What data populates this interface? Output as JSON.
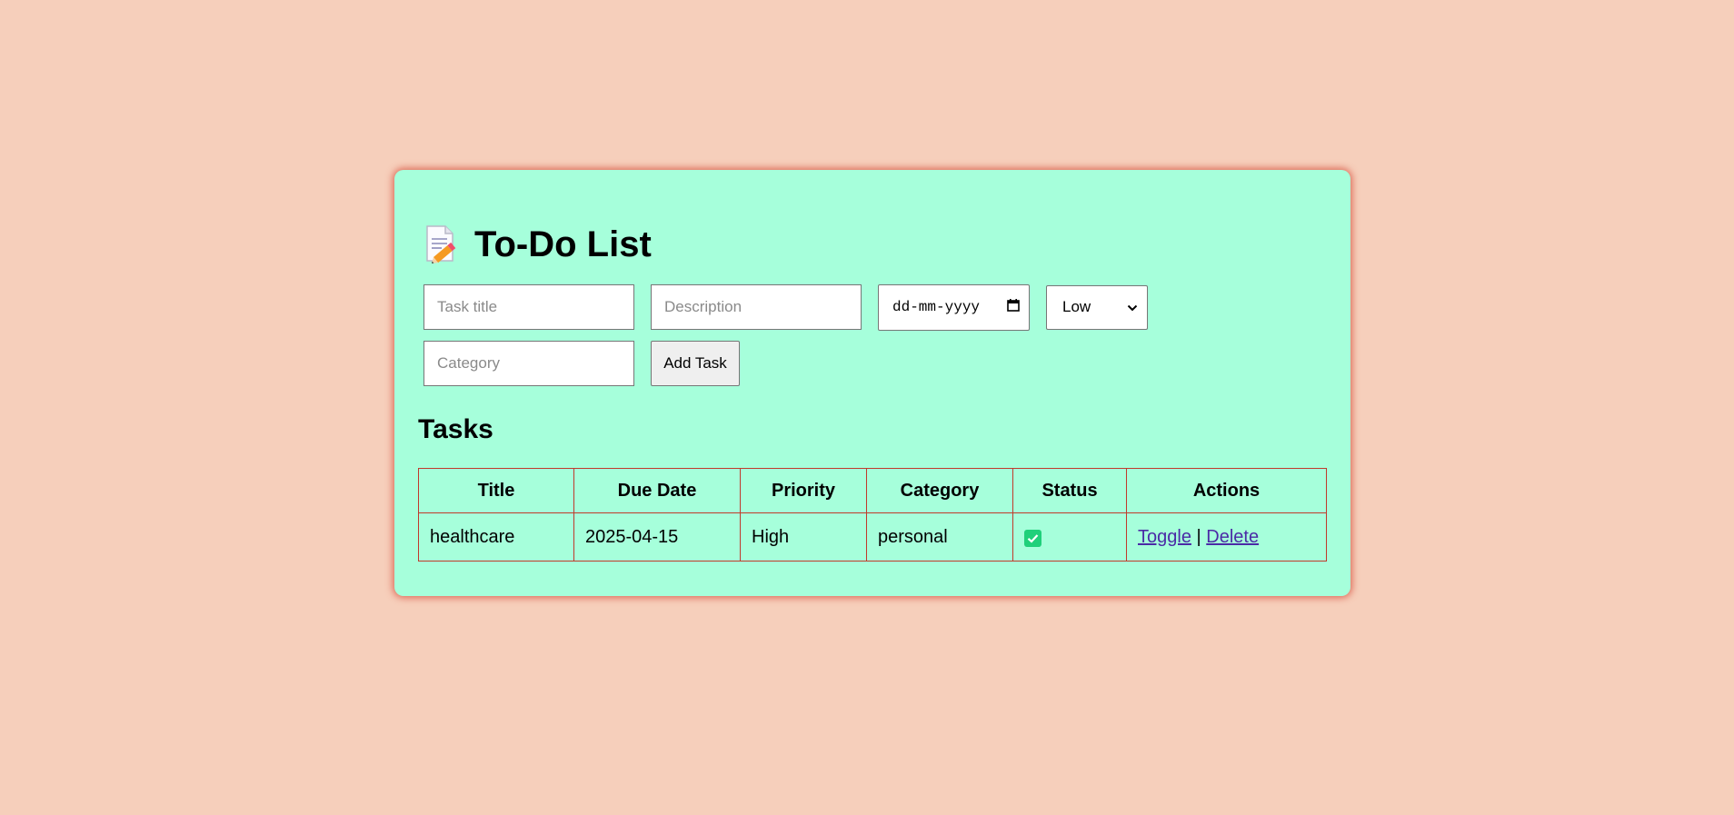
{
  "app": {
    "title": "To-Do List",
    "title_icon": "memo-icon"
  },
  "form": {
    "title_placeholder": "Task title",
    "description_placeholder": "Description",
    "date_placeholder": "dd-mm-yyyy",
    "priority_selected": "Low",
    "category_placeholder": "Category",
    "add_label": "Add Task"
  },
  "tasks_heading": "Tasks",
  "table": {
    "headers": [
      "Title",
      "Due Date",
      "Priority",
      "Category",
      "Status",
      "Actions"
    ],
    "rows": [
      {
        "title": "healthcare",
        "due_date": "2025-04-15",
        "priority": "High",
        "category": "personal",
        "status_checked": true,
        "toggle_label": "Toggle",
        "separator": "|",
        "delete_label": "Delete"
      }
    ]
  },
  "colors": {
    "page_background": "#f6cfbb",
    "card_background": "#a6ffdb",
    "table_border": "#c0392b",
    "link": "#4b2aa6",
    "checkbox": "#1fd07a"
  }
}
